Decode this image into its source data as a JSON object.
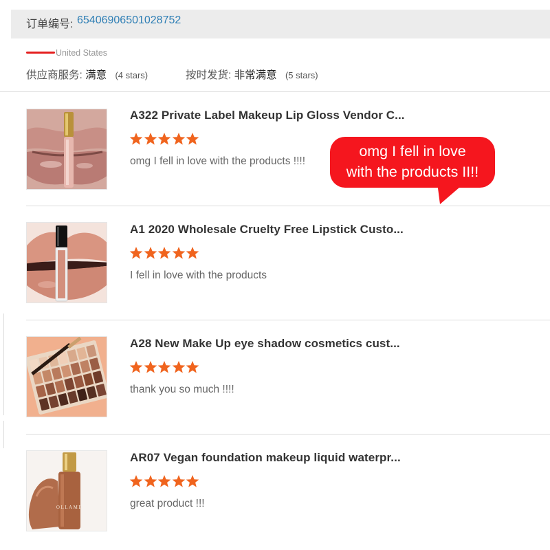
{
  "order": {
    "label": "订单编号:",
    "number": "65406906501028752"
  },
  "buyer": {
    "country": "United States"
  },
  "ratings": {
    "supplier": {
      "label": "供应商服务:",
      "value": "满意",
      "stars": "(4 stars)"
    },
    "delivery": {
      "label": "按时发货:",
      "value": "非常满意",
      "stars": "(5 stars)"
    }
  },
  "items": [
    {
      "title": "A322 Private Label Makeup Lip Gloss Vendor C...",
      "rating": 5,
      "comment": "omg I fell in love with the products !!!!",
      "thumb": "lip-gloss-product-image"
    },
    {
      "title": "A1 2020 Wholesale Cruelty Free Lipstick Custo...",
      "rating": 5,
      "comment": "I fell in love with the products",
      "thumb": "liquid-lipstick-product-image"
    },
    {
      "title": "A28 New Make Up eye shadow cosmetics cust...",
      "rating": 5,
      "comment": "thank you so much !!!!",
      "thumb": "eyeshadow-palette-product-image"
    },
    {
      "title": "AR07 Vegan foundation makeup liquid waterpr...",
      "rating": 5,
      "comment": "great product !!!",
      "thumb": "liquid-foundation-product-image"
    }
  ],
  "bubble": {
    "line1": "omg I fell in love",
    "line2": "with the products II!!"
  },
  "foundation_brand": "OLLAME",
  "colors": {
    "star": "#f0641e",
    "link": "#2f7fb5",
    "bubble": "#f5161e"
  }
}
